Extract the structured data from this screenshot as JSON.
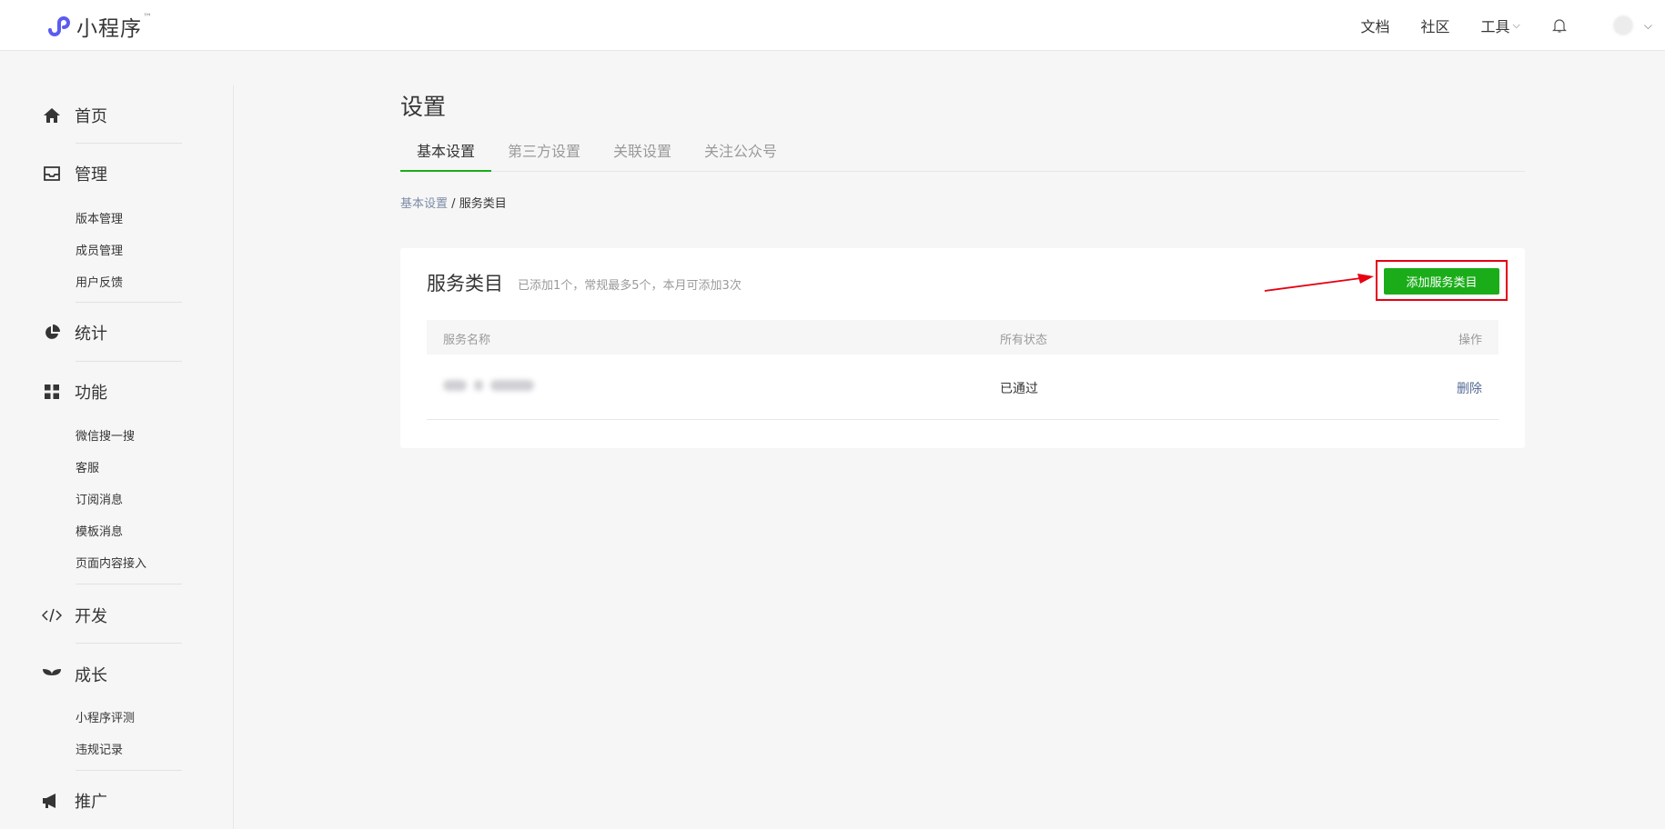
{
  "header": {
    "logo_text": "小程序",
    "logo_tm": "™",
    "nav": [
      {
        "label": "文档"
      },
      {
        "label": "社区"
      },
      {
        "label": "工具"
      }
    ],
    "icons": [
      "bell-icon",
      "avatar"
    ]
  },
  "sidebar": {
    "groups": [
      {
        "label": "首页",
        "icon": "home-icon",
        "items": []
      },
      {
        "label": "管理",
        "icon": "inbox-icon",
        "items": [
          "版本管理",
          "成员管理",
          "用户反馈"
        ]
      },
      {
        "label": "统计",
        "icon": "pie-chart-icon",
        "items": []
      },
      {
        "label": "功能",
        "icon": "grid-icon",
        "items": [
          "微信搜一搜",
          "客服",
          "订阅消息",
          "模板消息",
          "页面内容接入"
        ]
      },
      {
        "label": "开发",
        "icon": "code-icon",
        "items": []
      },
      {
        "label": "成长",
        "icon": "sprout-icon",
        "items": [
          "小程序评测",
          "违规记录"
        ]
      },
      {
        "label": "推广",
        "icon": "megaphone-icon",
        "items": []
      }
    ]
  },
  "main": {
    "title": "设置",
    "tabs": [
      {
        "label": "基本设置",
        "active": true
      },
      {
        "label": "第三方设置",
        "active": false
      },
      {
        "label": "关联设置",
        "active": false
      },
      {
        "label": "关注公众号",
        "active": false
      }
    ],
    "breadcrumb": {
      "parent": "基本设置",
      "separator": "/",
      "current": "服务类目"
    },
    "panel": {
      "title": "服务类目",
      "description": "已添加1个，常规最多5个，本月可添加3次",
      "add_button": "添加服务类目",
      "columns": [
        "服务名称",
        "所有状态",
        "操作"
      ],
      "rows": [
        {
          "name": "",
          "status": "已通过",
          "action": "删除"
        }
      ]
    }
  },
  "colors": {
    "accent_green": "#1aad19",
    "link_blue": "#576b95",
    "annotation_red": "#e60012"
  }
}
